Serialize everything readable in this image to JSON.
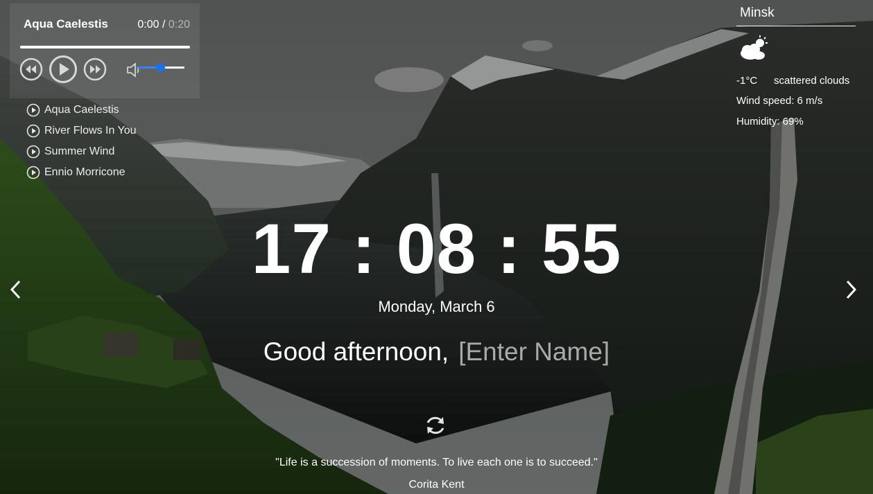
{
  "player": {
    "track_title": "Aqua Caelestis",
    "current_time": "0:00",
    "separator": " / ",
    "duration": "0:20",
    "progress": 0,
    "volume": 0.48,
    "playlist": [
      "Aqua Caelestis",
      "River Flows In You",
      "Summer Wind",
      "Ennio Morricone"
    ]
  },
  "weather": {
    "city": "Minsk",
    "icon": "scattered-clouds-icon",
    "temperature": "-1°C",
    "description": "scattered clouds",
    "wind": "Wind speed: 6 m/s",
    "humidity": "Humidity: 69%"
  },
  "clock": {
    "hours": "17",
    "minutes": "08",
    "seconds": "55",
    "separator": ":"
  },
  "date": "Monday, March 6",
  "greeting": {
    "text": "Good afternoon,",
    "name_placeholder": "[Enter Name]"
  },
  "quote": {
    "text": "\"Life is a succession of moments. To live each one is to succeed.\"",
    "author": "Corita Kent"
  },
  "colors": {
    "accent": "#1f6fe6",
    "placeholder": "#a9a9a9"
  }
}
